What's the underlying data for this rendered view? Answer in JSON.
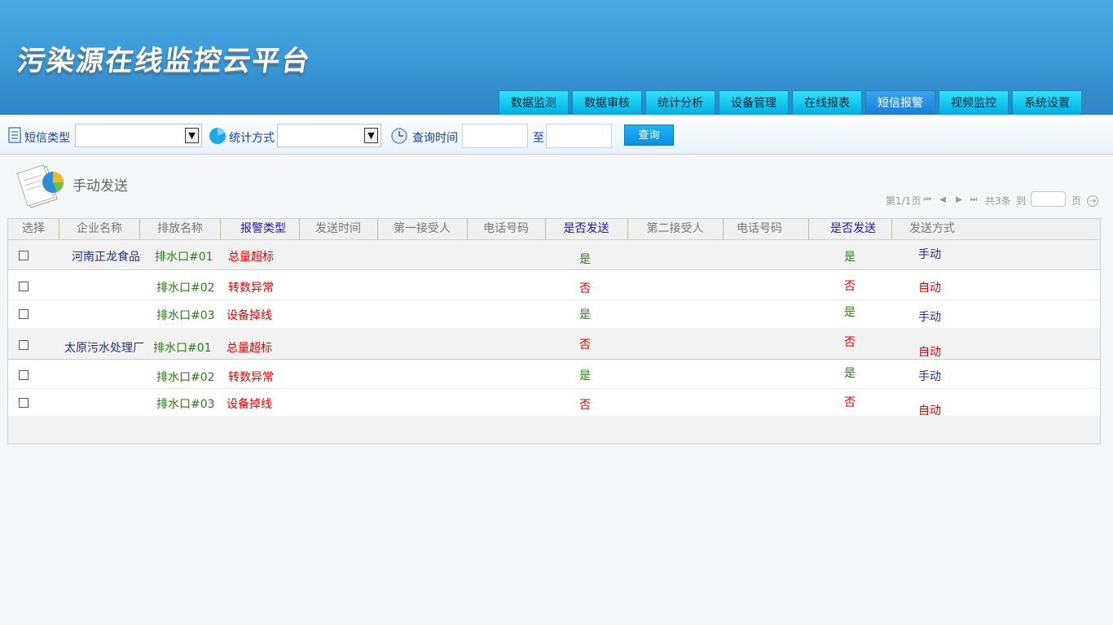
{
  "app": {
    "title": "污染源在线监控云平台"
  },
  "nav": {
    "tabs": [
      {
        "label": "数据监测",
        "active": false
      },
      {
        "label": "数据审核",
        "active": false
      },
      {
        "label": "统计分析",
        "active": false
      },
      {
        "label": "设备管理",
        "active": false
      },
      {
        "label": "在线报表",
        "active": false
      },
      {
        "label": "短信报警",
        "active": true
      },
      {
        "label": "视频监控",
        "active": false
      },
      {
        "label": "系统设置",
        "active": false
      }
    ]
  },
  "filters": {
    "sms_type_label": "短信类型",
    "sms_type_value": "",
    "stat_method_label": "统计方式",
    "stat_method_value": "",
    "query_time_label": "查询时间",
    "time_from": "",
    "to_label": "至",
    "time_to": "",
    "query_button": "查询"
  },
  "section": {
    "title": "手动发送"
  },
  "pagination": {
    "page_info": "第1/1页",
    "total": "共3条",
    "goto_label": "到",
    "page_suffix": "页",
    "page_input": ""
  },
  "table": {
    "headers": [
      "选择",
      "企业名称",
      "排放名称",
      "报警类型",
      "发送时间",
      "第一接受人",
      "电话号码",
      "是否发送",
      "第二接受人",
      "电话号码",
      "是否发送",
      "发送方式"
    ],
    "rows": [
      {
        "company": "河南正龙食品",
        "outlet": "排水口#01",
        "alarm": "总量超标",
        "send1": "是",
        "send2": "是",
        "method": "手动"
      },
      {
        "company": "",
        "outlet": "排水口#02",
        "alarm": "转数异常",
        "send1": "否",
        "send2": "否",
        "method": "自动"
      },
      {
        "company": "",
        "outlet": "排水口#03",
        "alarm": "设备掉线",
        "send1": "是",
        "send2": "是",
        "method": "手动"
      },
      {
        "company": "太原污水处理厂",
        "outlet": "排水口#01",
        "alarm": "总量超标",
        "send1": "否",
        "send2": "否",
        "method": "自动"
      },
      {
        "company": "",
        "outlet": "排水口#02",
        "alarm": "转数异常",
        "send1": "是",
        "send2": "是",
        "method": "手动"
      },
      {
        "company": "",
        "outlet": "排水口#03",
        "alarm": "设备掉线",
        "send1": "否",
        "send2": "否",
        "method": "自动"
      }
    ]
  },
  "colors": {
    "header_blue": "#3d9bd9",
    "tab_cyan": "#12c6ee",
    "tab_active": "#1a7fd8",
    "yes_green": "#2d7a1a",
    "no_red": "#e00000",
    "manual_navy": "#1f2f8a"
  }
}
